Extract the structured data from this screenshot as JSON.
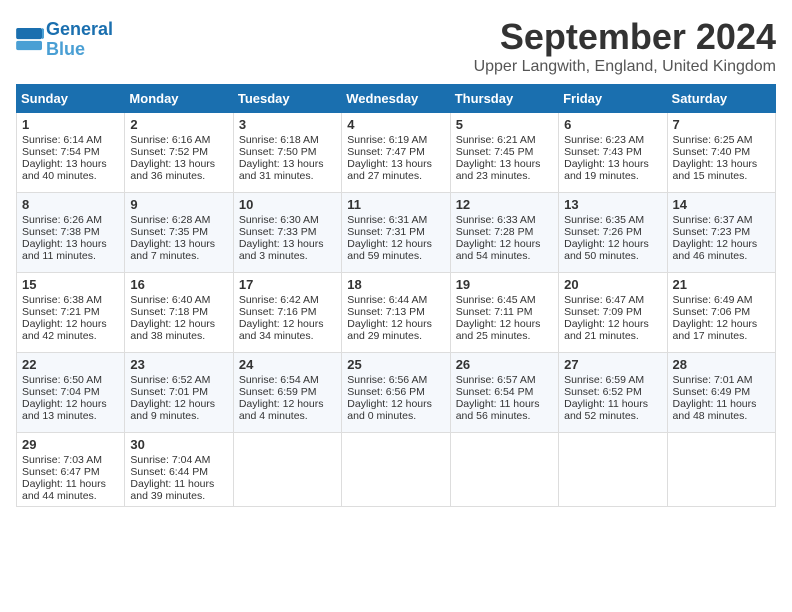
{
  "logo": {
    "line1": "General",
    "line2": "Blue"
  },
  "title": "September 2024",
  "location": "Upper Langwith, England, United Kingdom",
  "days_header": [
    "Sunday",
    "Monday",
    "Tuesday",
    "Wednesday",
    "Thursday",
    "Friday",
    "Saturday"
  ],
  "weeks": [
    [
      {
        "day": "1",
        "lines": [
          "Sunrise: 6:14 AM",
          "Sunset: 7:54 PM",
          "Daylight: 13 hours",
          "and 40 minutes."
        ]
      },
      {
        "day": "2",
        "lines": [
          "Sunrise: 6:16 AM",
          "Sunset: 7:52 PM",
          "Daylight: 13 hours",
          "and 36 minutes."
        ]
      },
      {
        "day": "3",
        "lines": [
          "Sunrise: 6:18 AM",
          "Sunset: 7:50 PM",
          "Daylight: 13 hours",
          "and 31 minutes."
        ]
      },
      {
        "day": "4",
        "lines": [
          "Sunrise: 6:19 AM",
          "Sunset: 7:47 PM",
          "Daylight: 13 hours",
          "and 27 minutes."
        ]
      },
      {
        "day": "5",
        "lines": [
          "Sunrise: 6:21 AM",
          "Sunset: 7:45 PM",
          "Daylight: 13 hours",
          "and 23 minutes."
        ]
      },
      {
        "day": "6",
        "lines": [
          "Sunrise: 6:23 AM",
          "Sunset: 7:43 PM",
          "Daylight: 13 hours",
          "and 19 minutes."
        ]
      },
      {
        "day": "7",
        "lines": [
          "Sunrise: 6:25 AM",
          "Sunset: 7:40 PM",
          "Daylight: 13 hours",
          "and 15 minutes."
        ]
      }
    ],
    [
      {
        "day": "8",
        "lines": [
          "Sunrise: 6:26 AM",
          "Sunset: 7:38 PM",
          "Daylight: 13 hours",
          "and 11 minutes."
        ]
      },
      {
        "day": "9",
        "lines": [
          "Sunrise: 6:28 AM",
          "Sunset: 7:35 PM",
          "Daylight: 13 hours",
          "and 7 minutes."
        ]
      },
      {
        "day": "10",
        "lines": [
          "Sunrise: 6:30 AM",
          "Sunset: 7:33 PM",
          "Daylight: 13 hours",
          "and 3 minutes."
        ]
      },
      {
        "day": "11",
        "lines": [
          "Sunrise: 6:31 AM",
          "Sunset: 7:31 PM",
          "Daylight: 12 hours",
          "and 59 minutes."
        ]
      },
      {
        "day": "12",
        "lines": [
          "Sunrise: 6:33 AM",
          "Sunset: 7:28 PM",
          "Daylight: 12 hours",
          "and 54 minutes."
        ]
      },
      {
        "day": "13",
        "lines": [
          "Sunrise: 6:35 AM",
          "Sunset: 7:26 PM",
          "Daylight: 12 hours",
          "and 50 minutes."
        ]
      },
      {
        "day": "14",
        "lines": [
          "Sunrise: 6:37 AM",
          "Sunset: 7:23 PM",
          "Daylight: 12 hours",
          "and 46 minutes."
        ]
      }
    ],
    [
      {
        "day": "15",
        "lines": [
          "Sunrise: 6:38 AM",
          "Sunset: 7:21 PM",
          "Daylight: 12 hours",
          "and 42 minutes."
        ]
      },
      {
        "day": "16",
        "lines": [
          "Sunrise: 6:40 AM",
          "Sunset: 7:18 PM",
          "Daylight: 12 hours",
          "and 38 minutes."
        ]
      },
      {
        "day": "17",
        "lines": [
          "Sunrise: 6:42 AM",
          "Sunset: 7:16 PM",
          "Daylight: 12 hours",
          "and 34 minutes."
        ]
      },
      {
        "day": "18",
        "lines": [
          "Sunrise: 6:44 AM",
          "Sunset: 7:13 PM",
          "Daylight: 12 hours",
          "and 29 minutes."
        ]
      },
      {
        "day": "19",
        "lines": [
          "Sunrise: 6:45 AM",
          "Sunset: 7:11 PM",
          "Daylight: 12 hours",
          "and 25 minutes."
        ]
      },
      {
        "day": "20",
        "lines": [
          "Sunrise: 6:47 AM",
          "Sunset: 7:09 PM",
          "Daylight: 12 hours",
          "and 21 minutes."
        ]
      },
      {
        "day": "21",
        "lines": [
          "Sunrise: 6:49 AM",
          "Sunset: 7:06 PM",
          "Daylight: 12 hours",
          "and 17 minutes."
        ]
      }
    ],
    [
      {
        "day": "22",
        "lines": [
          "Sunrise: 6:50 AM",
          "Sunset: 7:04 PM",
          "Daylight: 12 hours",
          "and 13 minutes."
        ]
      },
      {
        "day": "23",
        "lines": [
          "Sunrise: 6:52 AM",
          "Sunset: 7:01 PM",
          "Daylight: 12 hours",
          "and 9 minutes."
        ]
      },
      {
        "day": "24",
        "lines": [
          "Sunrise: 6:54 AM",
          "Sunset: 6:59 PM",
          "Daylight: 12 hours",
          "and 4 minutes."
        ]
      },
      {
        "day": "25",
        "lines": [
          "Sunrise: 6:56 AM",
          "Sunset: 6:56 PM",
          "Daylight: 12 hours",
          "and 0 minutes."
        ]
      },
      {
        "day": "26",
        "lines": [
          "Sunrise: 6:57 AM",
          "Sunset: 6:54 PM",
          "Daylight: 11 hours",
          "and 56 minutes."
        ]
      },
      {
        "day": "27",
        "lines": [
          "Sunrise: 6:59 AM",
          "Sunset: 6:52 PM",
          "Daylight: 11 hours",
          "and 52 minutes."
        ]
      },
      {
        "day": "28",
        "lines": [
          "Sunrise: 7:01 AM",
          "Sunset: 6:49 PM",
          "Daylight: 11 hours",
          "and 48 minutes."
        ]
      }
    ],
    [
      {
        "day": "29",
        "lines": [
          "Sunrise: 7:03 AM",
          "Sunset: 6:47 PM",
          "Daylight: 11 hours",
          "and 44 minutes."
        ]
      },
      {
        "day": "30",
        "lines": [
          "Sunrise: 7:04 AM",
          "Sunset: 6:44 PM",
          "Daylight: 11 hours",
          "and 39 minutes."
        ]
      },
      {
        "day": "",
        "lines": []
      },
      {
        "day": "",
        "lines": []
      },
      {
        "day": "",
        "lines": []
      },
      {
        "day": "",
        "lines": []
      },
      {
        "day": "",
        "lines": []
      }
    ]
  ]
}
